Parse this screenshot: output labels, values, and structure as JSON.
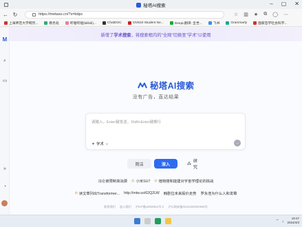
{
  "browser": {
    "window_title": "秘塔AI搜索",
    "url": "https://metaso.cn/?s=bdpc",
    "bookmarks": [
      {
        "label": "上海师范大学网页...",
        "color": "#c33"
      },
      {
        "label": "教务处",
        "color": "#3a7"
      },
      {
        "label": "哔哩哔哩(bilibili)...",
        "color": "#e77ea6"
      },
      {
        "label": "ChatDOC",
        "color": "#333"
      },
      {
        "label": "CNN10 Student Ne...",
        "color": "#c22"
      },
      {
        "label": "DeepL翻译: 全世...",
        "color": "#1a3"
      },
      {
        "label": "飞书",
        "color": "#3a8ef0"
      },
      {
        "label": "Grammarly",
        "color": "#1a9"
      },
      {
        "label": "国家哲学社会科学...",
        "color": "#c33"
      }
    ]
  },
  "banner": {
    "prefix": "新增了",
    "highlight": "学术搜索",
    "suffix": "，将搜索框内的\"全网\"切换至\"学术\"以使用"
  },
  "logo_text": "秘塔AI搜索",
  "slogan": "没有广告，直达结果",
  "search": {
    "placeholder": "请输入，Enter键发送，Shift+Enter键换行",
    "scope_label": "学术"
  },
  "modes": {
    "simple": "简洁",
    "deep": "深入",
    "research": "研究"
  },
  "suggestions_row1": [
    "冯仑被限制高消费",
    "小米SU7",
    "植物搭和能建对宇宙学理论的挑战"
  ],
  "suggestions_row2": [
    "读文章列出Transformer...",
    "http://mtw.so/62Q2LW",
    "韩剧拉未来股价走势",
    "罗永浩为什么人和发霉"
  ],
  "footer": [
    "联系我们",
    "加入我们",
    "沪ICP备18049811号-2",
    "沪公网安备31011502020948号"
  ],
  "taskbar": {
    "time": "19:47",
    "date": "2024/4/3",
    "accent": "#2f6bf0"
  }
}
